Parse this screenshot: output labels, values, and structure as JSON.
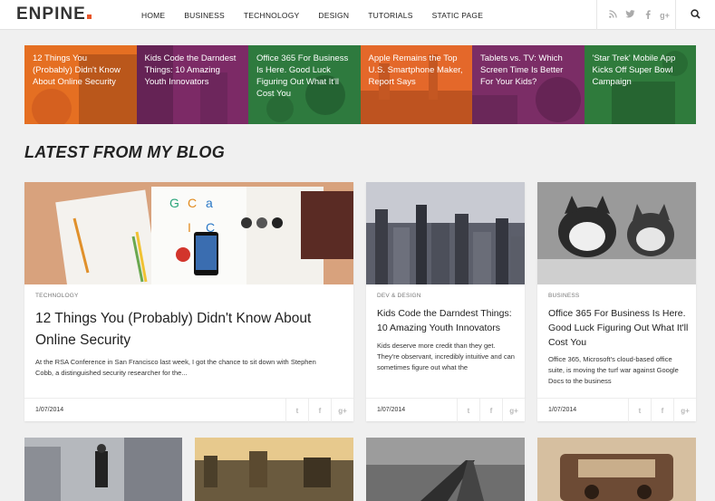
{
  "header": {
    "logo": "ENPINE",
    "nav": [
      "HOME",
      "BUSINESS",
      "TECHNOLOGY",
      "DESIGN",
      "TUTORIALS",
      "STATIC PAGE"
    ],
    "social_icons": [
      "rss-icon",
      "twitter-icon",
      "facebook-icon",
      "google-plus-icon"
    ],
    "search_icon": "search-icon"
  },
  "featured": [
    {
      "title": "12 Things You (Probably) Didn't Know About Online Security",
      "color": "#e56f22"
    },
    {
      "title": "Kids Code the Darndest Things: 10 Amazing Youth Innovators",
      "color": "#8a2f6d"
    },
    {
      "title": "Office 365 For Business Is Here. Good Luck Figuring Out What It'll Cost You",
      "color": "#2f7a3c"
    },
    {
      "title": "Apple Remains the Top U.S. Smartphone Maker, Report Says",
      "color": "#e86a24"
    },
    {
      "title": "Tablets vs. TV: Which Screen Time Is Better For Your Kids?",
      "color": "#7d2f6a"
    },
    {
      "title": "'Star Trek' Mobile App Kicks Off Super Bowl Campaign",
      "color": "#2f7a3c"
    }
  ],
  "section_title": "LATEST FROM MY BLOG",
  "posts": [
    {
      "category": "TECHNOLOGY",
      "title": "12 Things You (Probably) Didn't Know About Online Security",
      "excerpt": "At the RSA Conference in San Francisco last week, I got the chance to sit down with Stephen Cobb, a distinguished security researcher for the...",
      "date": "1/07/2014"
    },
    {
      "category": "DEV & DESIGN",
      "title": "Kids Code the Darndest Things: 10 Amazing Youth Innovators",
      "excerpt": "Kids deserve more credit than they get. They're observant, incredibly intuitive and can sometimes figure out what the",
      "date": "1/07/2014"
    },
    {
      "category": "BUSINESS",
      "title": "Office 365 For Business Is Here. Good Luck Figuring Out What It'll Cost You",
      "excerpt": "Office 365, Microsoft's cloud-based office suite, is moving the turf war against Google Docs to the business",
      "date": "1/07/2014"
    }
  ],
  "share_icons": {
    "twitter": "twitter-icon",
    "facebook": "facebook-icon",
    "google_plus": "google-plus-icon"
  },
  "share_glyphs": {
    "twitter": "t",
    "facebook": "f",
    "google_plus": "g+"
  }
}
